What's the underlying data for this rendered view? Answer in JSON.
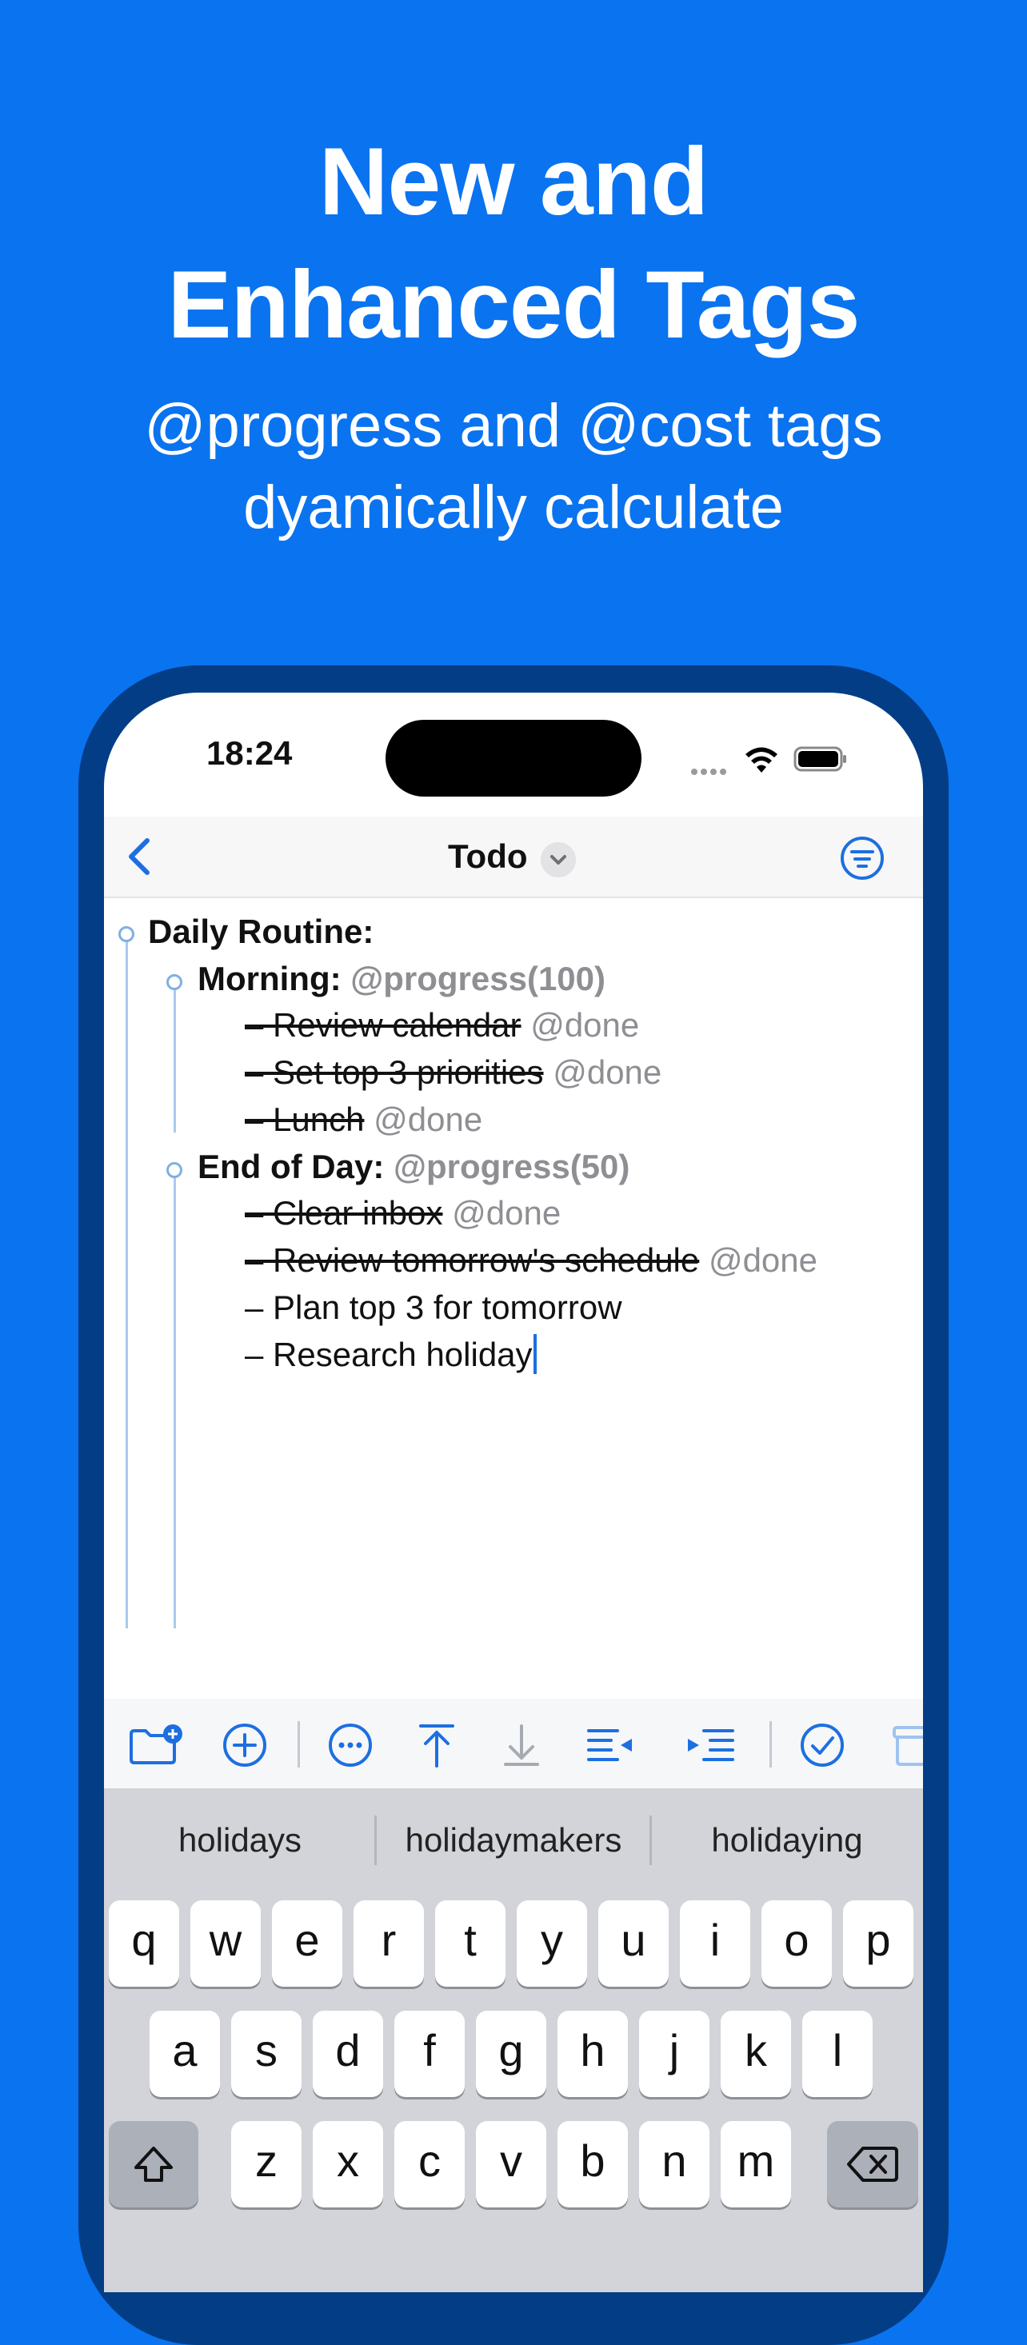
{
  "promo": {
    "headline_line1": "New and",
    "headline_line2": "Enhanced Tags",
    "subline_line1": "@progress and @cost tags",
    "subline_line2": "dyamically calculate"
  },
  "status_bar": {
    "time": "18:24",
    "icons": [
      "cellular-dots-icon",
      "wifi-icon",
      "battery-icon"
    ]
  },
  "nav": {
    "title": "Todo",
    "back_icon": "chevron-left-icon",
    "title_menu_icon": "chevron-down-icon",
    "filter_icon": "filter-icon"
  },
  "outline": {
    "root": "Daily Routine:",
    "morning": {
      "label": "Morning:",
      "tag": "@progress(100)"
    },
    "morning_items": [
      {
        "text": "– Review calendar",
        "tag": "@done",
        "done": true
      },
      {
        "text": "– Set top 3 priorities",
        "tag": "@done",
        "done": true
      },
      {
        "text": "– Lunch",
        "tag": "@done",
        "done": true
      }
    ],
    "evening": {
      "label": "End of Day:",
      "tag": "@progress(50)"
    },
    "evening_items": [
      {
        "text": "– Clear inbox",
        "tag": "@done",
        "done": true
      },
      {
        "text": "– Review tomorrow's schedule",
        "tag": "@done",
        "done": true
      },
      {
        "text": "– Plan top 3 for tomorrow",
        "tag": "",
        "done": false
      },
      {
        "text": "– Research holiday",
        "tag": "",
        "done": false
      }
    ]
  },
  "toolbar": {
    "icons": [
      "new-folder-icon",
      "add-item-icon",
      "more-icon",
      "move-to-top-icon",
      "move-down-icon",
      "outdent-icon",
      "indent-icon",
      "complete-icon",
      "archive-icon"
    ],
    "accent": "#1d6fe0"
  },
  "keyboard": {
    "suggestions": [
      "holidays",
      "holidaymakers",
      "holidaying"
    ],
    "row1": [
      "q",
      "w",
      "e",
      "r",
      "t",
      "y",
      "u",
      "i",
      "o",
      "p"
    ],
    "row2": [
      "a",
      "s",
      "d",
      "f",
      "g",
      "h",
      "j",
      "k",
      "l"
    ],
    "row3": [
      "z",
      "x",
      "c",
      "v",
      "b",
      "n",
      "m"
    ],
    "special": [
      "shift-icon",
      "delete-icon"
    ]
  }
}
